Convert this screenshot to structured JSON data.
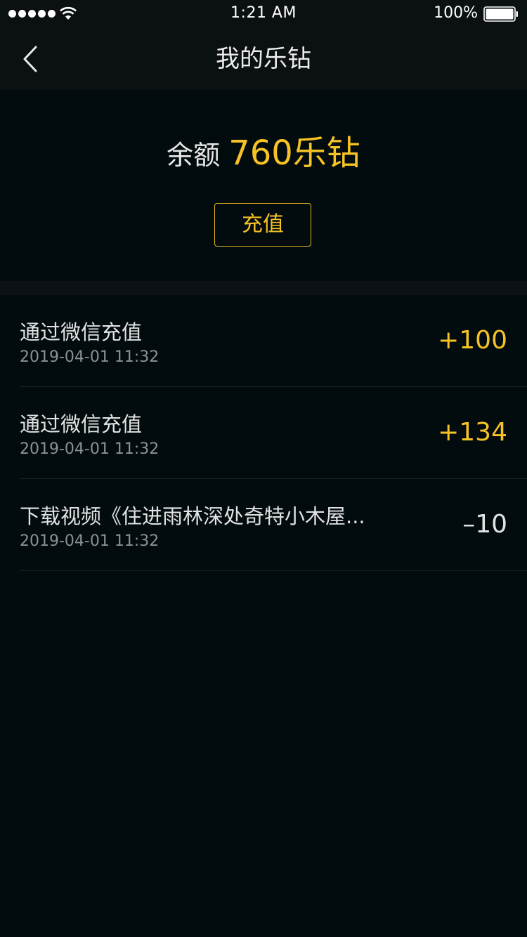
{
  "status_bar": {
    "time": "1:21 AM",
    "battery": "100%",
    "icons": [
      "signal-dots",
      "wifi-icon",
      "battery-icon"
    ]
  },
  "nav": {
    "title": "我的乐钻",
    "back_icon": "chevron-left-icon"
  },
  "balance": {
    "label": "余额",
    "value": "760乐钻",
    "recharge_label": "充值"
  },
  "colors": {
    "accent": "#f6c324",
    "background": "#020b0e",
    "header": "#0b1013",
    "text": "#e2e2e2",
    "muted": "#8d9194"
  },
  "transactions": [
    {
      "title": "通过微信充值",
      "time": "2019-04-01 11:32",
      "amount": "+100",
      "type": "pos"
    },
    {
      "title": "通过微信充值",
      "time": "2019-04-01 11:32",
      "amount": "+134",
      "type": "pos"
    },
    {
      "title": "下载视频《住进雨林深处奇特小木屋...",
      "time": "2019-04-01 11:32",
      "amount": "–10",
      "type": "neg"
    }
  ]
}
